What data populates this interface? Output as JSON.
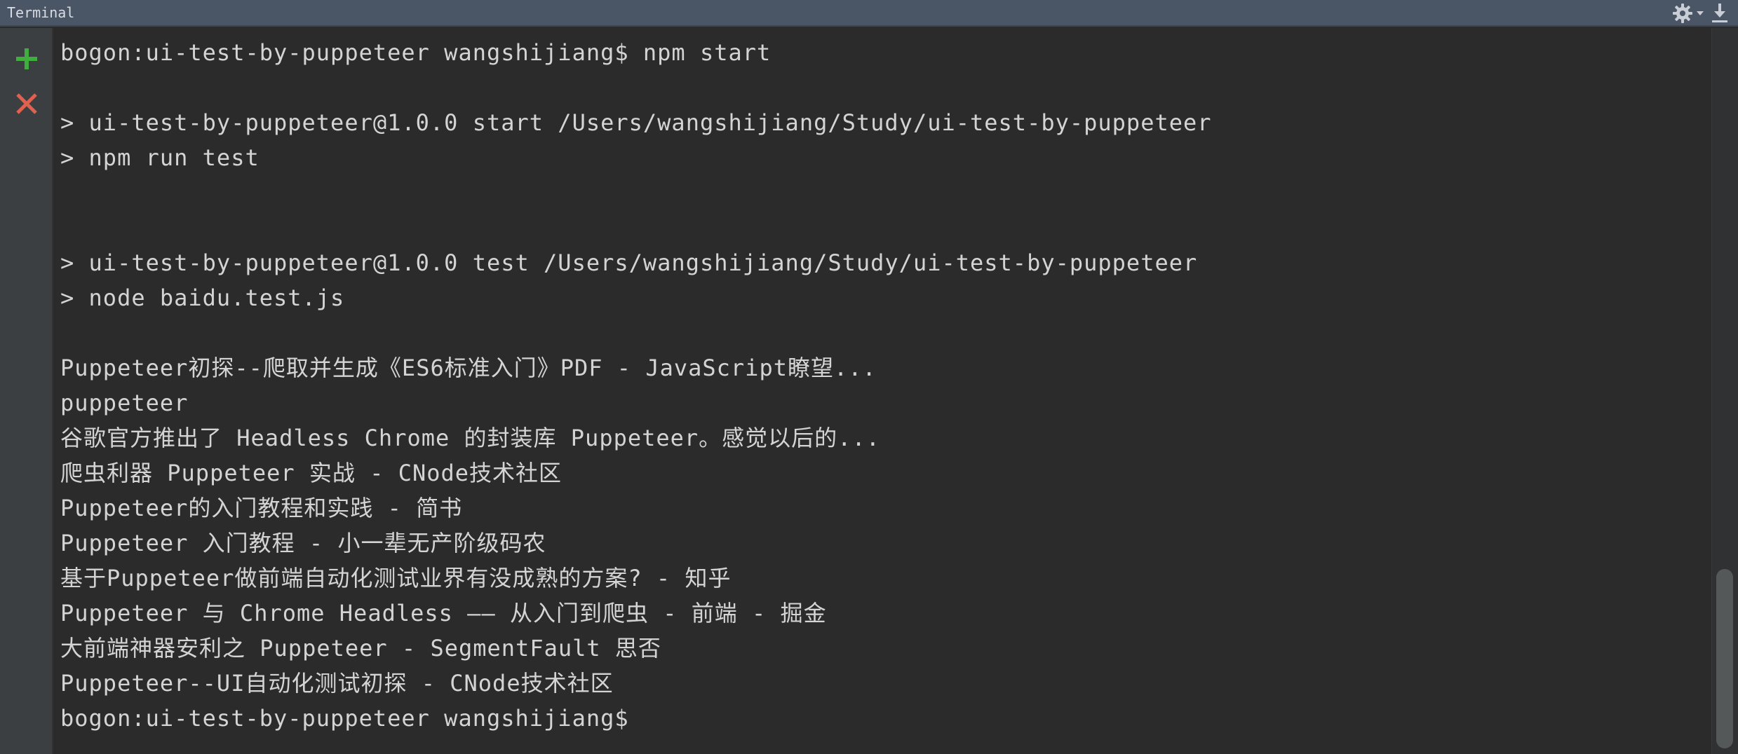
{
  "window": {
    "title": "Terminal",
    "settings_icon": "gear-icon",
    "hide_icon": "download-icon"
  },
  "sidebar": {
    "new_session_icon": "plus-icon",
    "close_session_icon": "close-icon",
    "colors": {
      "plus": "#3fae3f",
      "close": "#e0614f"
    }
  },
  "terminal": {
    "lines": [
      "bogon:ui-test-by-puppeteer wangshijiang$ npm start",
      "",
      "> ui-test-by-puppeteer@1.0.0 start /Users/wangshijiang/Study/ui-test-by-puppeteer",
      "> npm run test",
      "",
      "",
      "> ui-test-by-puppeteer@1.0.0 test /Users/wangshijiang/Study/ui-test-by-puppeteer",
      "> node baidu.test.js",
      "",
      "Puppeteer初探--爬取并生成《ES6标准入门》PDF - JavaScript瞭望...",
      "puppeteer",
      "谷歌官方推出了 Headless Chrome 的封装库 Puppeteer。感觉以后的...",
      "爬虫利器 Puppeteer 实战 - CNode技术社区",
      "Puppeteer的入门教程和实践 - 简书",
      "Puppeteer 入门教程 - 小一辈无产阶级码农",
      "基于Puppeteer做前端自动化测试业界有没成熟的方案? - 知乎",
      "Puppeteer 与 Chrome Headless —— 从入门到爬虫 - 前端 - 掘金",
      "大前端神器安利之 Puppeteer - SegmentFault 思否",
      "Puppeteer--UI自动化测试初探 - CNode技术社区",
      "bogon:ui-test-by-puppeteer wangshijiang$"
    ]
  }
}
